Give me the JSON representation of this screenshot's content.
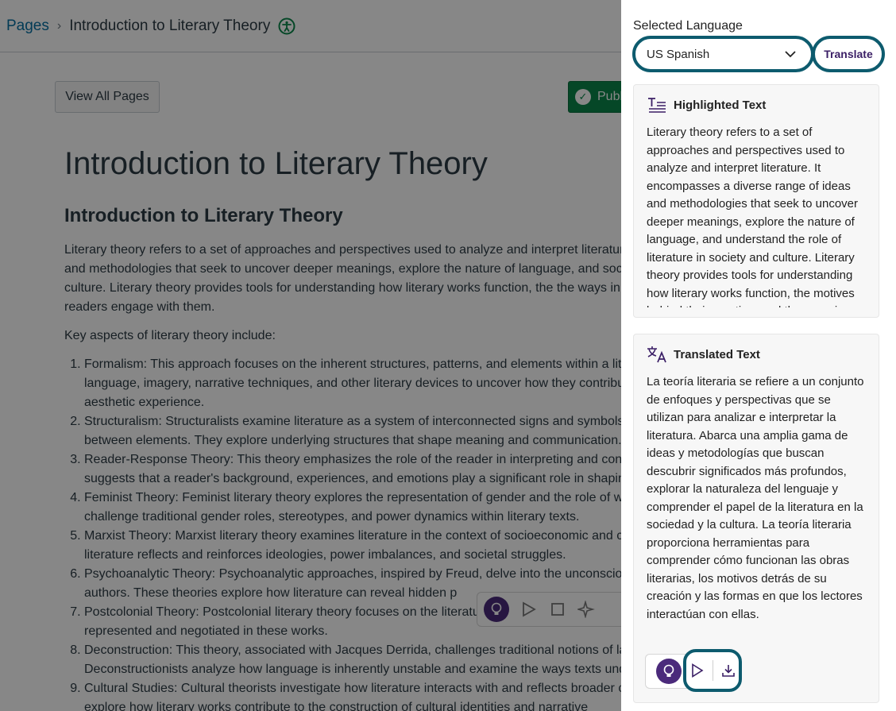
{
  "breadcrumb": {
    "root": "Pages",
    "separator": "›",
    "current": "Introduction to Literary Theory"
  },
  "header_icons": {
    "accessibility": "accessibility-icon"
  },
  "buttons": {
    "view_all_pages": "View All Pages",
    "publish": "Publ"
  },
  "page": {
    "title": "Introduction to Literary Theory",
    "heading": "Introduction to Literary Theory",
    "intro": "Literary theory refers to a set of approaches and perspectives used to analyze and interpret literature ideas and methodologies that seek to uncover deeper meanings, explore the nature of language, and society and culture. Literary theory provides tools for understanding how literary works function, the the ways in which readers engage with them.",
    "key_aspects": "Key aspects of literary theory include:",
    "list": [
      "Formalism: This approach focuses on the inherent structures, patterns, and elements within a lite language, imagery, narrative techniques, and other literary devices to uncover how they contribut aesthetic experience.",
      "Structuralism: Structuralists examine literature as a system of interconnected signs and symbols, between elements. They explore underlying structures that shape meaning and communication.",
      "Reader-Response Theory: This theory emphasizes the role of the reader in interpreting and const suggests that a reader's background, experiences, and emotions play a significant role in shaping",
      "Feminist Theory: Feminist literary theory explores the representation of gender and the role of wo and challenge traditional gender roles, stereotypes, and power dynamics within literary texts.",
      "Marxist Theory: Marxist literary theory examines literature in the context of socioeconomic and c literature reflects and reinforces ideologies, power imbalances, and societal struggles.",
      "Psychoanalytic Theory: Psychoanalytic approaches, inspired by Freud, delve into the unconscious and authors. These theories explore how literature can reveal hidden p",
      "Postcolonial Theory: Postcolonial literary theory focuses on the literatu identity, and cultural hybridity are represented and negotiated in these works.",
      "Deconstruction: This theory, associated with Jacques Derrida, challenges traditional notions of la Deconstructionists analyze how language is inherently unstable and examine the ways texts unde",
      "Cultural Studies: Cultural theorists investigate how literature interacts with and reflects broader c They explore how literary works contribute to the construction of cultural identities and narrative"
    ]
  },
  "panel": {
    "language_label": "Selected Language",
    "language_value": "US Spanish",
    "translate_label": "Translate",
    "highlighted": {
      "title": "Highlighted Text",
      "text": "Literary theory refers to a set of approaches and perspectives used to analyze and interpret literature. It encompasses a diverse range of ideas and methodologies that seek to uncover deeper meanings, explore the nature of language, and understand the role of literature in society and culture. Literary theory provides tools for understanding how literary works function, the motives behind their creation, and the ways in"
    },
    "translated": {
      "title": "Translated Text",
      "text": "La teoría literaria se refiere a un conjunto de enfoques y perspectivas que se utilizan para analizar e interpretar la literatura. Abarca una amplia gama de ideas y metodologías que buscan descubrir significados más profundos, explorar la naturaleza del lenguaje y comprender el papel de la literatura en la sociedad y la cultura. La teoría literaria proporciona herramientas para comprender cómo funcionan las obras literarias, los motivos detrás de su creación y las formas en que los lectores interactúan con ellas."
    }
  },
  "colors": {
    "focus_ring": "#0d5b6e",
    "brand_purple": "#4b2a7b",
    "link_blue": "#0770a3",
    "publish_green": "#0b874b"
  }
}
